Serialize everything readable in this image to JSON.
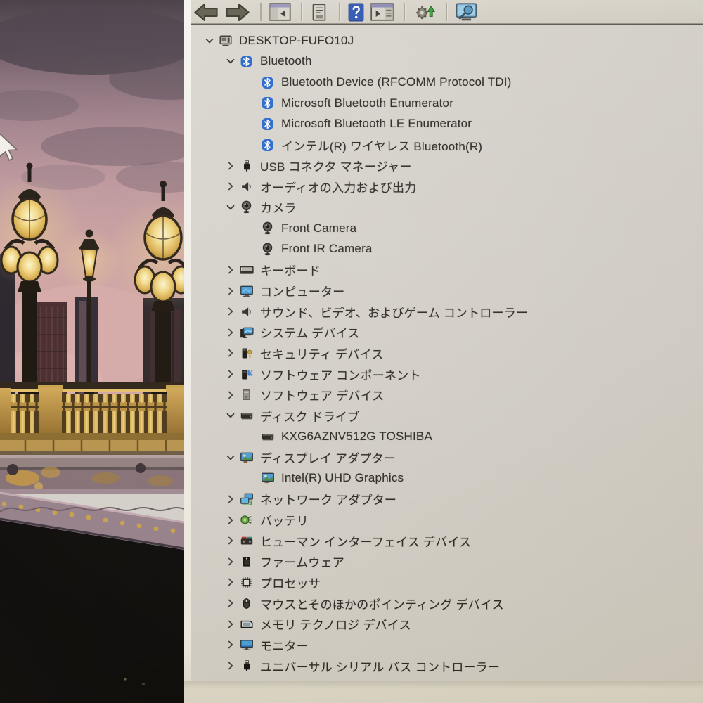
{
  "window": {
    "computer_name": "DESKTOP-FUFO10J"
  },
  "toolbar": {
    "buttons": [
      {
        "id": "back",
        "icon": "back-arrow-icon",
        "svg": "arrowL"
      },
      {
        "id": "forward",
        "icon": "forward-arrow-icon",
        "svg": "arrowR"
      },
      {
        "id": "sep"
      },
      {
        "id": "console-tree",
        "icon": "window-left-pane-icon",
        "svg": "winL"
      },
      {
        "id": "sep"
      },
      {
        "id": "properties",
        "icon": "document-icon",
        "svg": "doc"
      },
      {
        "id": "sep"
      },
      {
        "id": "help",
        "icon": "help-question-icon",
        "svg": "help"
      },
      {
        "id": "action-pane",
        "icon": "window-right-pane-icon",
        "svg": "winR"
      },
      {
        "id": "sep"
      },
      {
        "id": "update-driver",
        "icon": "gear-green-arrow-icon",
        "svg": "gearUp"
      },
      {
        "id": "sep"
      },
      {
        "id": "scan-hardware",
        "icon": "computer-magnifier-icon",
        "svg": "pcSearch"
      }
    ]
  },
  "tree": {
    "items": [
      {
        "id": "desktop-fufo10j",
        "level": 0,
        "state": "expanded",
        "icon": "computer-root-icon",
        "label": "DESKTOP-FUFO10J"
      },
      {
        "id": "bluetooth",
        "level": 1,
        "state": "expanded",
        "icon": "bluetooth-icon",
        "label": "Bluetooth"
      },
      {
        "id": "bluetooth-device-rfcomm",
        "level": 2,
        "state": "none",
        "icon": "bluetooth-icon",
        "label": "Bluetooth Device (RFCOMM Protocol TDI)"
      },
      {
        "id": "microsoft-bluetooth-enumerator",
        "level": 2,
        "state": "none",
        "icon": "bluetooth-icon",
        "label": "Microsoft Bluetooth Enumerator"
      },
      {
        "id": "microsoft-bluetooth-le-enumerator",
        "level": 2,
        "state": "none",
        "icon": "bluetooth-icon",
        "label": "Microsoft Bluetooth LE Enumerator"
      },
      {
        "id": "intel-wireless-bluetooth",
        "level": 2,
        "state": "none",
        "icon": "bluetooth-icon",
        "label": "インテル(R) ワイヤレス Bluetooth(R)"
      },
      {
        "id": "usb-connector-manager",
        "level": 1,
        "state": "collapsed",
        "icon": "usb-plug-icon",
        "label": "USB コネクタ マネージャー"
      },
      {
        "id": "audio-inputs-outputs",
        "level": 1,
        "state": "collapsed",
        "icon": "speaker-icon",
        "label": "オーディオの入力および出力"
      },
      {
        "id": "camera",
        "level": 1,
        "state": "expanded",
        "icon": "webcam-icon",
        "label": "カメラ"
      },
      {
        "id": "front-camera",
        "level": 2,
        "state": "none",
        "icon": "webcam-icon",
        "label": "Front Camera"
      },
      {
        "id": "front-ir-camera",
        "level": 2,
        "state": "none",
        "icon": "webcam-icon",
        "label": "Front IR Camera"
      },
      {
        "id": "keyboard",
        "level": 1,
        "state": "collapsed",
        "icon": "keyboard-icon",
        "label": "キーボード"
      },
      {
        "id": "computer",
        "level": 1,
        "state": "collapsed",
        "icon": "monitor-blue-icon",
        "label": "コンピューター"
      },
      {
        "id": "sound-video-game-controllers",
        "level": 1,
        "state": "collapsed",
        "icon": "speaker-icon",
        "label": "サウンド、ビデオ、およびゲーム コントローラー"
      },
      {
        "id": "system-devices",
        "level": 1,
        "state": "collapsed",
        "icon": "system-devices-icon",
        "label": "システム デバイス"
      },
      {
        "id": "security-devices",
        "level": 1,
        "state": "collapsed",
        "icon": "security-key-icon",
        "label": "セキュリティ デバイス"
      },
      {
        "id": "software-components",
        "level": 1,
        "state": "collapsed",
        "icon": "software-component-icon",
        "label": "ソフトウェア コンポーネント"
      },
      {
        "id": "software-devices",
        "level": 1,
        "state": "collapsed",
        "icon": "software-device-icon",
        "label": "ソフトウェア デバイス"
      },
      {
        "id": "disk-drives",
        "level": 1,
        "state": "expanded",
        "icon": "disk-drive-icon",
        "label": "ディスク ドライブ"
      },
      {
        "id": "kxg6aznv512g-toshiba",
        "level": 2,
        "state": "none",
        "icon": "disk-drive-icon",
        "label": "KXG6AZNV512G TOSHIBA"
      },
      {
        "id": "display-adapters",
        "level": 1,
        "state": "expanded",
        "icon": "display-adapter-icon",
        "label": "ディスプレイ アダプター"
      },
      {
        "id": "intel-uhd-graphics",
        "level": 2,
        "state": "none",
        "icon": "display-adapter-icon",
        "label": "Intel(R) UHD Graphics"
      },
      {
        "id": "network-adapters",
        "level": 1,
        "state": "collapsed",
        "icon": "network-adapter-icon",
        "label": "ネットワーク アダプター"
      },
      {
        "id": "batteries",
        "level": 1,
        "state": "collapsed",
        "icon": "battery-icon",
        "label": "バッテリ"
      },
      {
        "id": "human-interface-devices",
        "level": 1,
        "state": "collapsed",
        "icon": "hid-icon",
        "label": "ヒューマン インターフェイス デバイス"
      },
      {
        "id": "firmware",
        "level": 1,
        "state": "collapsed",
        "icon": "firmware-chip-icon",
        "label": "ファームウェア"
      },
      {
        "id": "processors",
        "level": 1,
        "state": "collapsed",
        "icon": "processor-chip-icon",
        "label": "プロセッサ"
      },
      {
        "id": "mice-pointing-devices",
        "level": 1,
        "state": "collapsed",
        "icon": "mouse-icon",
        "label": "マウスとそのほかのポインティング デバイス"
      },
      {
        "id": "memory-technology-devices",
        "level": 1,
        "state": "collapsed",
        "icon": "memory-card-icon",
        "label": "メモリ テクノロジ デバイス"
      },
      {
        "id": "monitors",
        "level": 1,
        "state": "collapsed",
        "icon": "monitor-icon",
        "label": "モニター"
      },
      {
        "id": "universal-serial-bus-controllers",
        "level": 1,
        "state": "collapsed",
        "icon": "usb-plug-icon",
        "label": "ユニバーサル シリアル バス コントローラー"
      }
    ]
  },
  "colors": {
    "bluetooth_blue": "#2668cf",
    "window_bg": "#d6d2cb",
    "toolbar_bg": "#d9d5cc",
    "status_bg": "#dcd6c5",
    "text": "#2b2722",
    "wallpaper_sky_top": "#453b44",
    "wallpaper_sky_pink": "#cda1a2",
    "wallpaper_lamp_gold": "#edcc6e",
    "wallpaper_shadow": "#0c0a08"
  }
}
